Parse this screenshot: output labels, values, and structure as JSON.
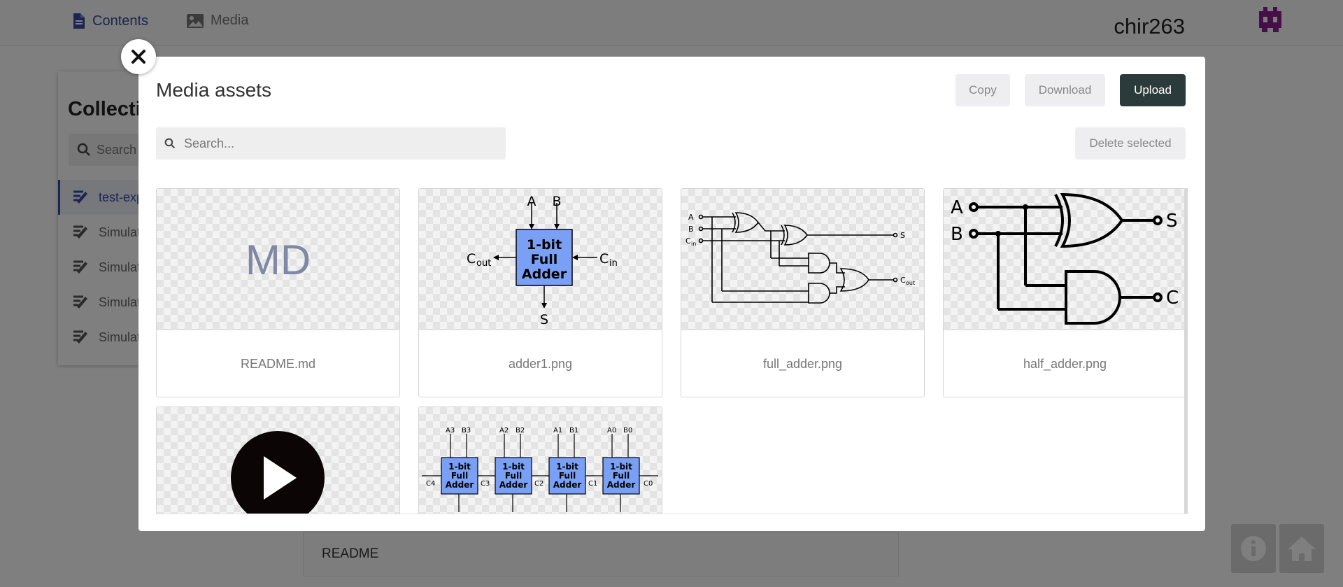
{
  "topbar": {
    "nav": [
      {
        "label": "Contents",
        "icon": "document-icon"
      },
      {
        "label": "Media",
        "icon": "image-icon"
      }
    ],
    "username": "chir263",
    "accent": "#3a49a6",
    "logo_color": "#8a1f8f"
  },
  "sidebar": {
    "title": "Collecti",
    "search_placeholder": "Search",
    "items": [
      {
        "label": "test-exp",
        "active": true
      },
      {
        "label": "Simulat",
        "active": false
      },
      {
        "label": "Simulat",
        "active": false
      },
      {
        "label": "Simulat",
        "active": false
      },
      {
        "label": "Simulat",
        "active": false
      }
    ]
  },
  "readme_label": "README",
  "modal": {
    "title": "Media assets",
    "buttons": {
      "copy": "Copy",
      "download": "Download",
      "upload": "Upload",
      "delete_selected": "Delete selected"
    },
    "search": {
      "placeholder": "Search...",
      "value": ""
    },
    "assets": [
      {
        "name": "README.md",
        "thumb_text": "MD",
        "kind": "markdown"
      },
      {
        "name": "adder1.png",
        "kind": "image"
      },
      {
        "name": "full_adder.png",
        "kind": "image"
      },
      {
        "name": "half_adder.png",
        "kind": "image"
      },
      {
        "name": "",
        "kind": "video"
      },
      {
        "name": "",
        "kind": "image"
      }
    ],
    "diagram_text": {
      "adder1": {
        "a": "A",
        "b": "B",
        "block": [
          "1-bit",
          "Full",
          "Adder"
        ],
        "cout": "C",
        "cout_sub": "out",
        "cin": "C",
        "cin_sub": "in",
        "s": "S"
      },
      "full_adder": {
        "a": "A",
        "b": "B",
        "cin": "C",
        "cin_sub": "in",
        "s": "S",
        "cout": "C",
        "cout_sub": "out"
      },
      "half_adder": {
        "a": "A",
        "b": "B",
        "s": "S",
        "c": "C"
      },
      "ripple": {
        "blocks": [
          {
            "a": "A3",
            "b": "B3",
            "cin": "C3"
          },
          {
            "a": "A2",
            "b": "B2",
            "cin": "C2"
          },
          {
            "a": "A1",
            "b": "B1",
            "cin": "C1"
          },
          {
            "a": "A0",
            "b": "B0",
            "cin": "C0"
          }
        ],
        "cout": "C4",
        "block": [
          "1-bit",
          "Full",
          "Adder"
        ]
      }
    },
    "colors": {
      "adder_block": "#7aa0f5",
      "upload_bg": "#2b3a3a"
    }
  }
}
